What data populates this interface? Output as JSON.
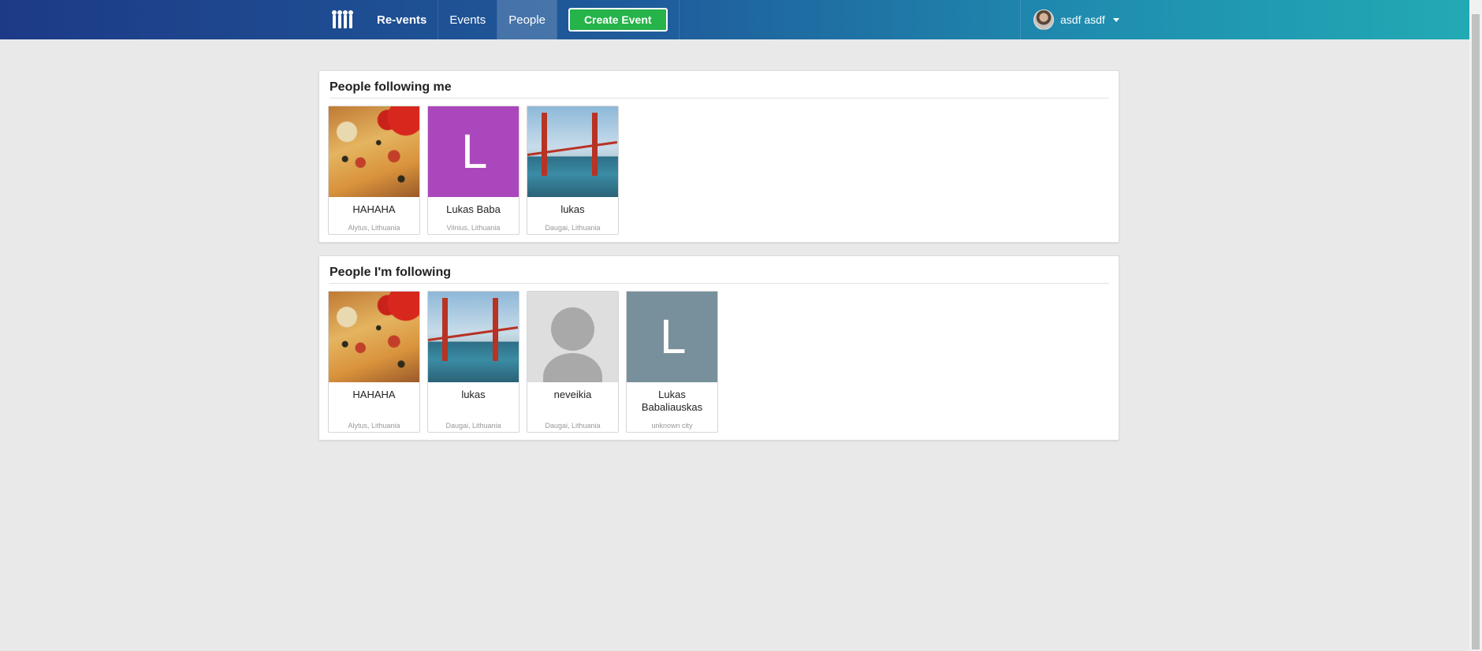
{
  "nav": {
    "logo_icon": "people-logo-icon",
    "brand": "Re-vents",
    "events": "Events",
    "people": "People",
    "create_event": "Create Event",
    "user_name": "asdf asdf"
  },
  "followers": {
    "title": "People following me",
    "people": [
      {
        "name": "HAHAHA",
        "location": "Alytus, Lithuania",
        "photo": "pizza"
      },
      {
        "name": "Lukas Baba",
        "location": "Vilnius, Lithuania",
        "photo": "letter",
        "letter": "L",
        "color": "#ab47bc"
      },
      {
        "name": "lukas",
        "location": "Daugai, Lithuania",
        "photo": "bridge"
      }
    ]
  },
  "following": {
    "title": "People I'm following",
    "people": [
      {
        "name": "HAHAHA",
        "location": "Alytus, Lithuania",
        "photo": "pizza"
      },
      {
        "name": "lukas",
        "location": "Daugai, Lithuania",
        "photo": "bridge"
      },
      {
        "name": "neveikia",
        "location": "Daugai, Lithuania",
        "photo": "default-avatar"
      },
      {
        "name": "Lukas Babaliauskas",
        "location": "unknown city",
        "photo": "letter",
        "letter": "L",
        "color": "#78909c"
      }
    ]
  }
}
